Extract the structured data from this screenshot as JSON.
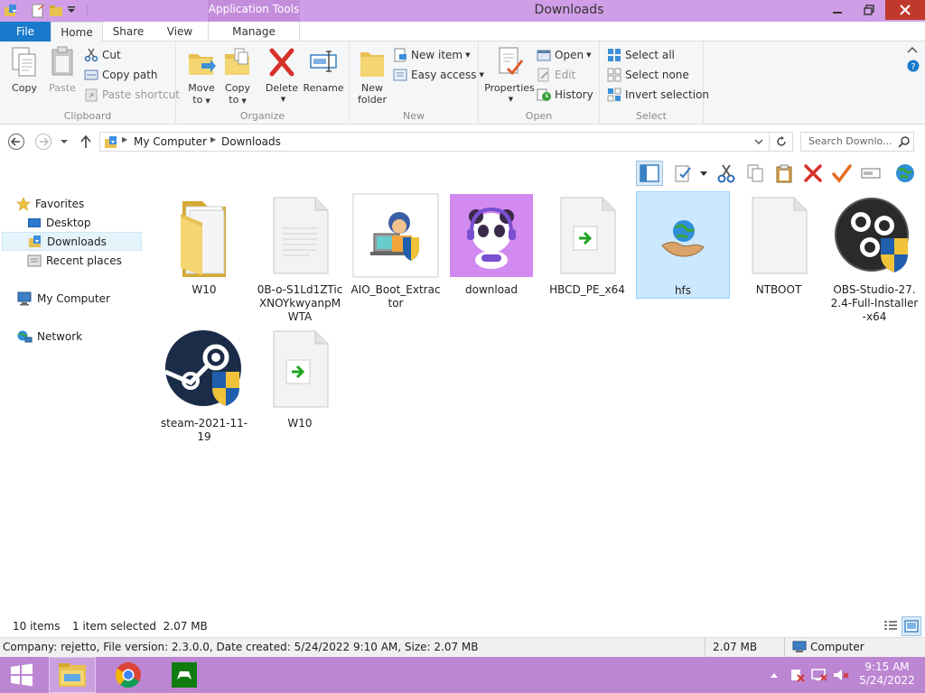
{
  "window": {
    "title": "Downloads",
    "context_tab": "Application Tools"
  },
  "tabs": [
    {
      "label": "File"
    },
    {
      "label": "Home"
    },
    {
      "label": "Share"
    },
    {
      "label": "View"
    },
    {
      "label": "Manage"
    }
  ],
  "ribbon": {
    "clipboard": {
      "label": "Clipboard",
      "copy": "Copy",
      "paste": "Paste",
      "cut": "Cut",
      "copy_path": "Copy path",
      "paste_shortcut": "Paste shortcut"
    },
    "organize": {
      "label": "Organize",
      "move_to_1": "Move",
      "move_to_2": "to",
      "copy_to_1": "Copy",
      "copy_to_2": "to",
      "delete": "Delete",
      "rename": "Rename"
    },
    "new": {
      "label": "New",
      "new_folder_1": "New",
      "new_folder_2": "folder",
      "new_item": "New item",
      "easy_access": "Easy access"
    },
    "open": {
      "label": "Open",
      "properties": "Properties",
      "open": "Open",
      "edit": "Edit",
      "history": "History"
    },
    "select": {
      "label": "Select",
      "select_all": "Select all",
      "select_none": "Select none",
      "invert": "Invert selection"
    }
  },
  "address": {
    "crumbs": [
      "My Computer",
      "Downloads"
    ],
    "search_placeholder": "Search Downlo..."
  },
  "nav": {
    "favorites": "Favorites",
    "desktop": "Desktop",
    "downloads": "Downloads",
    "recent": "Recent places",
    "computer": "My Computer",
    "network": "Network"
  },
  "files": [
    {
      "name": "W10",
      "icon": "folder-icon"
    },
    {
      "name": "0B-o-S1Ld1ZTicXNOYkwyanpMWTA",
      "icon": "document-icon"
    },
    {
      "name": "AIO_Boot_Extractor",
      "icon": "aio-boot-icon"
    },
    {
      "name": "download",
      "icon": "panda-image-icon"
    },
    {
      "name": "HBCD_PE_x64",
      "icon": "iso-file-icon"
    },
    {
      "name": "hfs",
      "icon": "hfs-globe-icon",
      "selected": true
    },
    {
      "name": "NTBOOT",
      "icon": "blank-file-icon"
    },
    {
      "name": "OBS-Studio-27.2.4-Full-Installer-x64",
      "icon": "obs-installer-icon"
    },
    {
      "name": "steam-2021-11-19",
      "icon": "steam-installer-icon"
    },
    {
      "name": "W10",
      "icon": "iso-file-icon"
    }
  ],
  "status": {
    "items": "10 items",
    "selected": "1 item selected  2.07 MB"
  },
  "infobar": {
    "details": "Company: rejetto, File version: 2.3.0.0, Date created: 5/24/2022 9:10 AM, Size: 2.07 MB",
    "size": "2.07 MB",
    "location": "Computer"
  },
  "taskbar": {
    "time": "9:15 AM",
    "date": "5/24/2022"
  },
  "colors": {
    "accent": "#1979ca",
    "titlebar": "#d09ee6",
    "taskbar": "#bc86d2",
    "selection": "#cce8ff"
  }
}
